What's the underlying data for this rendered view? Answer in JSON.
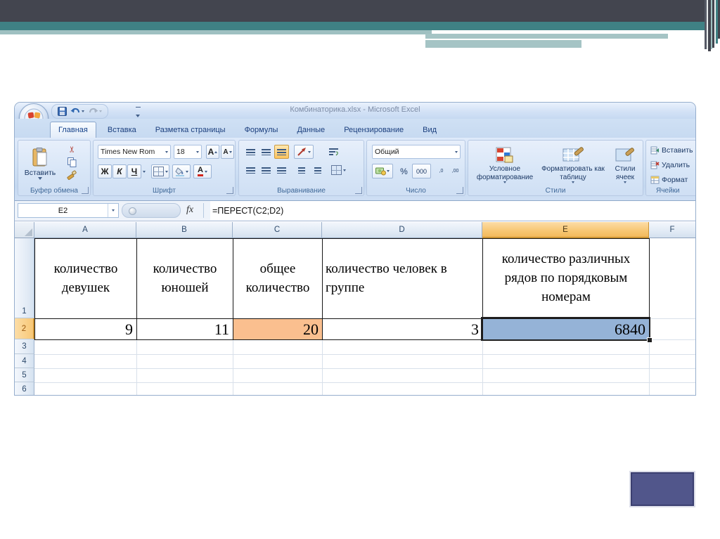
{
  "window": {
    "title": "Комбинаторика.xlsx - Microsoft Excel",
    "tabs": [
      "Главная",
      "Вставка",
      "Разметка страницы",
      "Формулы",
      "Данные",
      "Рецензирование",
      "Вид"
    ]
  },
  "ribbon": {
    "clipboard": {
      "label": "Буфер обмена",
      "paste": "Вставить"
    },
    "font": {
      "label": "Шрифт",
      "name": "Times New Rom",
      "size": "18",
      "bold": "Ж",
      "italic": "К",
      "underline": "Ч",
      "grow": "A",
      "shrink": "A",
      "color_letter": "A"
    },
    "alignment": {
      "label": "Выравнивание"
    },
    "number": {
      "label": "Число",
      "format": "Общий",
      "percent": "%",
      "thousands": "000",
      "dec_inc": ",0",
      "dec_dec": ",00"
    },
    "styles": {
      "label": "Стили",
      "conditional": "Условное форматирование",
      "as_table": "Форматировать как таблицу",
      "cell_styles": "Стили ячеек"
    },
    "cells": {
      "label": "Ячейки",
      "insert": "Вставить",
      "delete": "Удалить",
      "format": "Формат"
    }
  },
  "formula_bar": {
    "name_box": "E2",
    "fx": "fx",
    "formula": "=ПЕРЕСТ(C2;D2)"
  },
  "sheet": {
    "columns": [
      "A",
      "B",
      "C",
      "D",
      "E",
      "F"
    ],
    "rows": [
      "1",
      "2",
      "3",
      "4",
      "5",
      "6"
    ],
    "selected_cell": "E2",
    "header_cells": {
      "a": "количество девушек",
      "b": "количество юношей",
      "c": "общее количество",
      "d": "количество человек в группе",
      "e": "количество различных рядов по порядковым номерам"
    },
    "value_cells": {
      "a": "9",
      "b": "11",
      "c": "20",
      "d": "3",
      "e": "6840"
    }
  },
  "icons": {
    "scissors": "✂"
  },
  "colors": {
    "cell_c2_fill": "#FABF8F",
    "cell_e2_fill": "#95B3D7",
    "selected_header": "#F8C877",
    "slide_dark": "#43454F",
    "slide_teal": "#3F8184",
    "slide_sage": "#A5C4C5",
    "shape_purple": "#51568B"
  }
}
